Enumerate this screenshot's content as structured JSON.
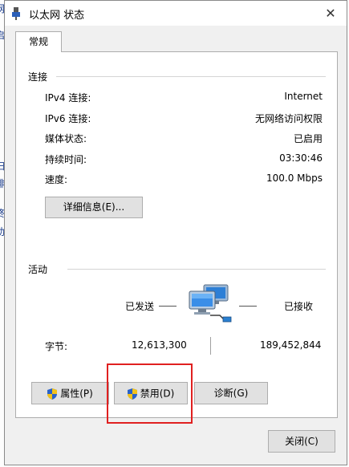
{
  "window": {
    "title": "以太网 状态",
    "close_glyph": "✕"
  },
  "background_chars": [
    "网",
    "启",
    "扫",
    "排",
    "终",
    "助"
  ],
  "tabs": [
    {
      "label": "常规"
    }
  ],
  "connection": {
    "group_title": "连接",
    "rows": [
      {
        "label": "IPv4 连接:",
        "value": "Internet"
      },
      {
        "label": "IPv6 连接:",
        "value": "无网络访问权限"
      },
      {
        "label": "媒体状态:",
        "value": "已启用"
      },
      {
        "label": "持续时间:",
        "value": "03:30:46"
      },
      {
        "label": "速度:",
        "value": "100.0 Mbps"
      }
    ],
    "details_button": "详细信息(E)..."
  },
  "activity": {
    "group_title": "活动",
    "sent_label": "已发送",
    "received_label": "已接收",
    "bytes_label": "字节:",
    "bytes_sent": "12,613,300",
    "bytes_received": "189,452,844",
    "icon": "network-computers-icon"
  },
  "buttons": {
    "properties": "属性(P)",
    "disable": "禁用(D)",
    "diagnose": "诊断(G)",
    "close": "关闭(C)"
  },
  "colors": {
    "highlight": "#e02020",
    "shield_blue": "#2a62c9",
    "shield_yellow": "#f2c21a"
  }
}
